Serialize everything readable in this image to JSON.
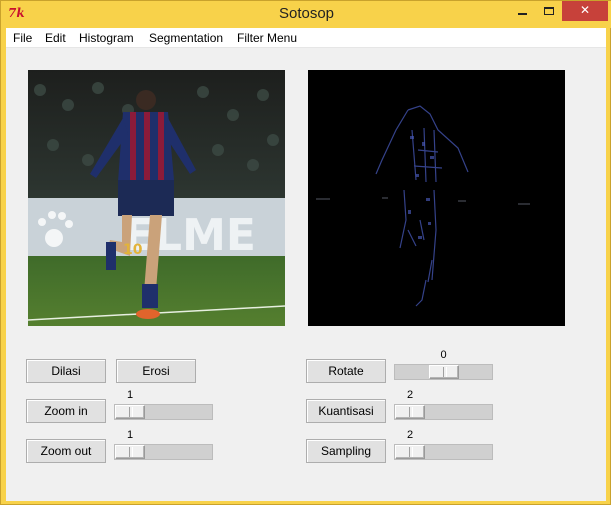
{
  "window": {
    "title": "Sotosop",
    "icon_text": "7k"
  },
  "menu": [
    "File",
    "Edit",
    "Histogram",
    "Segmentation",
    "Filter Menu"
  ],
  "buttons": {
    "dilasi": "Dilasi",
    "erosi": "Erosi",
    "zoom_in": "Zoom in",
    "zoom_out": "Zoom out",
    "rotate": "Rotate",
    "kuantisasi": "Kuantisasi",
    "sampling": "Sampling"
  },
  "sliders": {
    "zoom_in": {
      "value": "1",
      "level": 0
    },
    "zoom_out": {
      "value": "1",
      "level": 0
    },
    "rotate": {
      "value": "0",
      "level": 0.5
    },
    "kuantisasi": {
      "value": "2",
      "level": 0
    },
    "sampling": {
      "value": "2",
      "level": 0
    }
  },
  "images": {
    "original": "photo of a football player in a striped kit celebrating on a grass pitch with crowd and sponsor board behind",
    "processed": "black image with faint blue edge outline of the player"
  },
  "colors": {
    "title_bar": "#f8d24a",
    "close_button": "#c7413a",
    "window_bg": "#f0f0f0",
    "button_bg": "#e1e1e1"
  }
}
